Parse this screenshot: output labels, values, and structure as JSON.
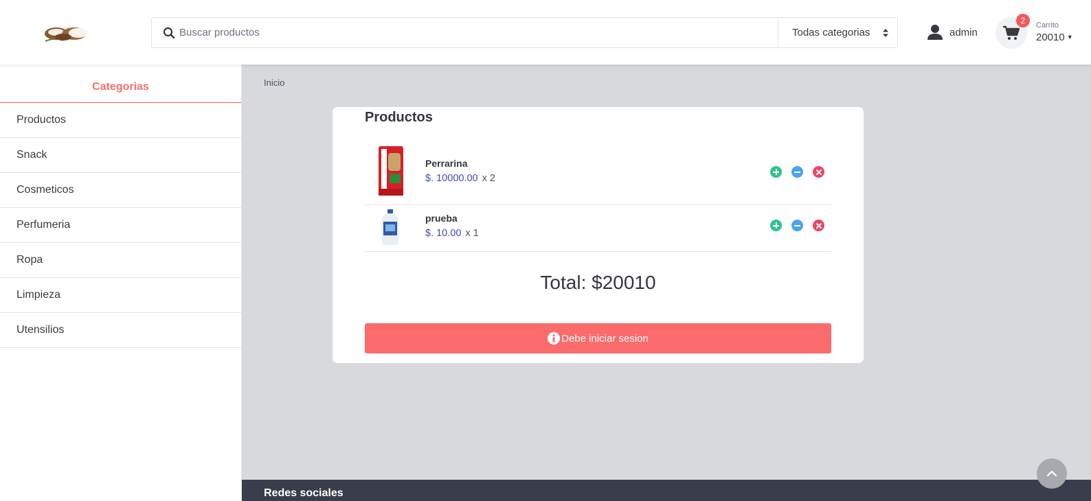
{
  "header": {
    "search_placeholder": "Buscar productos",
    "category_select": "Todas categorias",
    "user_name": "admin",
    "cart_badge": "2",
    "cart_label": "Carrito",
    "cart_total": "20010"
  },
  "sidebar": {
    "title": "Categorias",
    "items": [
      {
        "label": "Productos"
      },
      {
        "label": "Snack"
      },
      {
        "label": "Cosmeticos"
      },
      {
        "label": "Perfumeria"
      },
      {
        "label": "Ropa"
      },
      {
        "label": "Limpieza"
      },
      {
        "label": "Utensilios"
      }
    ]
  },
  "main": {
    "breadcrumb": "Inicio",
    "card_title": "Productos",
    "items": [
      {
        "name": "Perrarina",
        "price": "$. 10000.00",
        "qty": "x 2"
      },
      {
        "name": "prueba",
        "price": "$. 10.00",
        "qty": "x 1"
      }
    ],
    "total": "Total: $20010",
    "login_button": "Debe iniciar sesion"
  },
  "footer": {
    "title": "Redes sociales"
  },
  "colors": {
    "accent": "#f26e69",
    "price": "#3f49c7",
    "add": "#2dc38c",
    "minus": "#4aa2f2",
    "remove": "#ef4466",
    "button": "#fb6b6b"
  }
}
